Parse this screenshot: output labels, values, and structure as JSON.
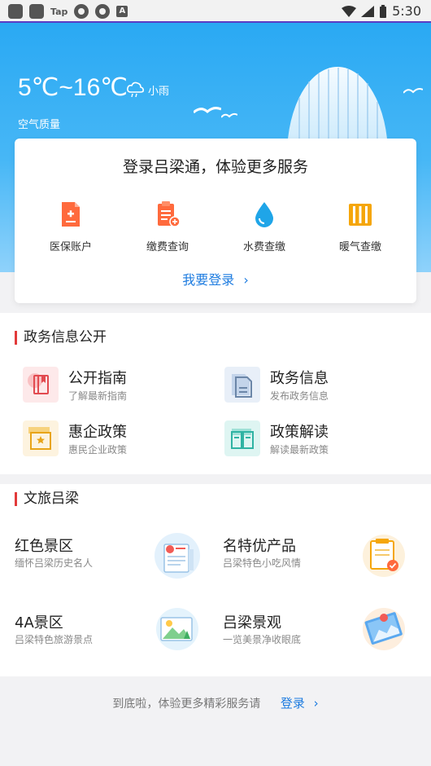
{
  "status_bar": {
    "left_tap": "Tap",
    "left_a": "A",
    "time": "5:30"
  },
  "weather": {
    "temperature": "5℃~16℃",
    "condition": "小雨",
    "air_quality": "空气质量"
  },
  "login_card": {
    "title": "登录吕梁通，体验更多服务",
    "services": [
      {
        "label": "医保账户",
        "icon": "medical-account-icon"
      },
      {
        "label": "缴费查询",
        "icon": "payment-query-icon"
      },
      {
        "label": "水费查缴",
        "icon": "water-drop-icon"
      },
      {
        "label": "暖气查缴",
        "icon": "radiator-icon"
      }
    ],
    "login_label": "我要登录",
    "login_arrow": "›"
  },
  "gov_section": {
    "title": "政务信息公开",
    "items": [
      {
        "name": "公开指南",
        "sub": "了解最新指南"
      },
      {
        "name": "政务信息",
        "sub": "发布政务信息"
      },
      {
        "name": "惠企政策",
        "sub": "惠民企业政策"
      },
      {
        "name": "政策解读",
        "sub": "解读最新政策"
      }
    ]
  },
  "tour_section": {
    "title": "文旅吕梁",
    "items": [
      {
        "name": "红色景区",
        "sub": "缅怀吕梁历史名人"
      },
      {
        "name": "名特优产品",
        "sub": "吕梁特色小吃风情"
      },
      {
        "name": "4A景区",
        "sub": "吕梁特色旅游景点"
      },
      {
        "name": "吕梁景观",
        "sub": "一览美景净收眼底"
      }
    ]
  },
  "footer": {
    "text": "到底啦，体验更多精彩服务请",
    "link_label": "登录",
    "link_arrow": "›"
  },
  "colors": {
    "accent": "#1e7ce0",
    "hero_top": "#2aa9f3",
    "section_bar": "#e23a3a",
    "orange": "#ff6a3d",
    "water": "#1fa5e8",
    "radiator": "#f5a60a"
  }
}
